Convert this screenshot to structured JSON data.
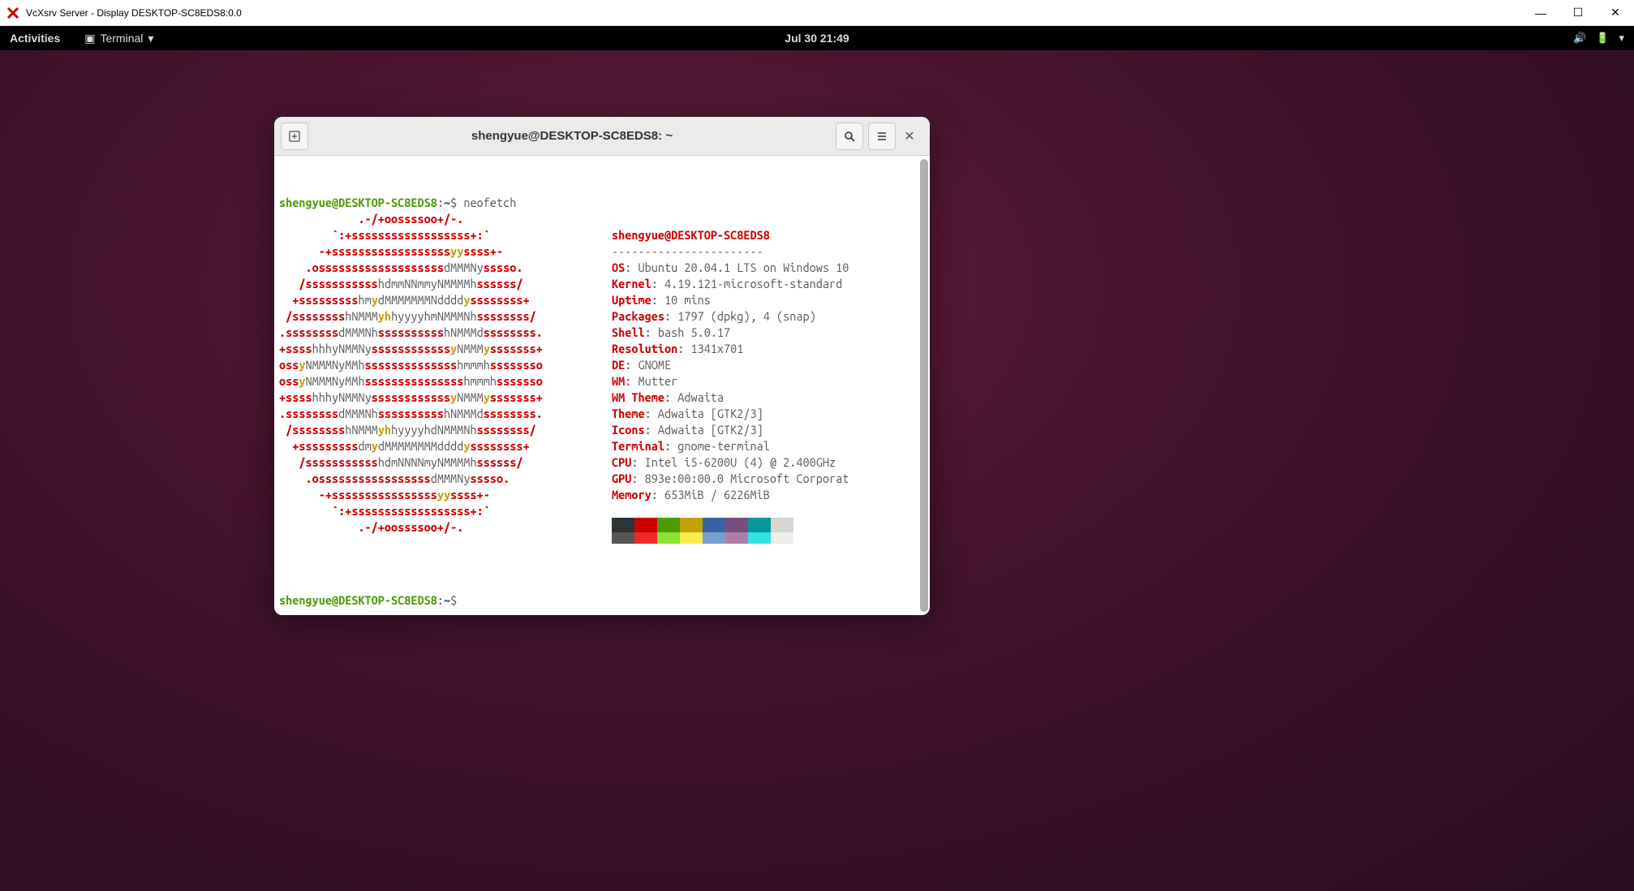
{
  "win": {
    "title": "VcXsrv Server - Display DESKTOP-SC8EDS8:0.0"
  },
  "gnome": {
    "activities": "Activities",
    "appmenu": "Terminal",
    "clock": "Jul 30  21:49"
  },
  "term": {
    "title": "shengyue@DESKTOP-SC8EDS8: ~",
    "prompt_user": "shengyue@DESKTOP-SC8EDS8",
    "prompt_sep": ":",
    "prompt_path": "~",
    "prompt_dollar": "$",
    "command": "neofetch",
    "header_user": "shengyue",
    "header_at": "@",
    "header_host": "DESKTOP-SC8EDS8",
    "dashes": "-----------------------",
    "info": {
      "os_k": "OS",
      "os_v": ": Ubuntu 20.04.1 LTS on Windows 10",
      "kernel_k": "Kernel",
      "kernel_v": ": 4.19.121-microsoft-standard",
      "uptime_k": "Uptime",
      "uptime_v": ": 10 mins",
      "packages_k": "Packages",
      "packages_v": ": 1797 (dpkg), 4 (snap)",
      "shell_k": "Shell",
      "shell_v": ": bash 5.0.17",
      "resolution_k": "Resolution",
      "resolution_v": ": 1341x701",
      "de_k": "DE",
      "de_v": ": GNOME",
      "wm_k": "WM",
      "wm_v": ": Mutter",
      "wmtheme_k": "WM Theme",
      "wmtheme_v": ": Adwaita",
      "theme_k": "Theme",
      "theme_v": ": Adwaita [GTK2/3]",
      "icons_k": "Icons",
      "icons_v": ": Adwaita [GTK2/3]",
      "terminal_k": "Terminal",
      "terminal_v": ": gnome-terminal",
      "cpu_k": "CPU",
      "cpu_v": ": Intel i5-6200U (4) @ 2.400GHz",
      "gpu_k": "GPU",
      "gpu_v": ": 893e:00:00.0 Microsoft Corporat",
      "memory_k": "Memory",
      "memory_v": ": 653MiB / 6226MiB"
    },
    "logo": [
      [
        [
          "r",
          "            .-/+oossssoo+/-."
        ]
      ],
      [
        [
          "r",
          "        `:+ssssssssssssssssss+:`"
        ]
      ],
      [
        [
          "r",
          "      -+ssssssssssssssssss"
        ],
        [
          "y",
          "yy"
        ],
        [
          "r",
          "ssss+-"
        ]
      ],
      [
        [
          "r",
          "    .osssssssssssssssssss"
        ],
        [
          "gr",
          "dMMMNy"
        ],
        [
          "r",
          "sssso."
        ]
      ],
      [
        [
          "r",
          "   /sssssssssss"
        ],
        [
          "gr",
          "hdmmNNmmyNMMMMh"
        ],
        [
          "r",
          "ssssss/"
        ]
      ],
      [
        [
          "r",
          "  +sssssssss"
        ],
        [
          "gr",
          "hm"
        ],
        [
          "y",
          "y"
        ],
        [
          "gr",
          "dMMMMMMMNdddd"
        ],
        [
          "y",
          "y"
        ],
        [
          "r",
          "ssssssss+"
        ]
      ],
      [
        [
          "r",
          " /ssssssss"
        ],
        [
          "gr",
          "hNMMM"
        ],
        [
          "y",
          "yh"
        ],
        [
          "gr",
          "hyyyyhmNMMMNh"
        ],
        [
          "r",
          "ssssssss/"
        ]
      ],
      [
        [
          "r",
          ".ssssssss"
        ],
        [
          "gr",
          "dMMMNh"
        ],
        [
          "r",
          "ssssssssss"
        ],
        [
          "gr",
          "hNMMMd"
        ],
        [
          "r",
          "ssssssss."
        ]
      ],
      [
        [
          "r",
          "+ssss"
        ],
        [
          "gr",
          "hhhyNMMNy"
        ],
        [
          "r",
          "ssssssssssss"
        ],
        [
          "y",
          "y"
        ],
        [
          "gr",
          "NMMM"
        ],
        [
          "y",
          "y"
        ],
        [
          "r",
          "sssssss+"
        ]
      ],
      [
        [
          "r",
          "oss"
        ],
        [
          "y",
          "y"
        ],
        [
          "gr",
          "NMMMNyMMh"
        ],
        [
          "r",
          "ssssssssssssss"
        ],
        [
          "gr",
          "hmmmh"
        ],
        [
          "r",
          "ssssssso"
        ]
      ],
      [
        [
          "r",
          "oss"
        ],
        [
          "y",
          "y"
        ],
        [
          "gr",
          "NMMMNyMMh"
        ],
        [
          "r",
          "sssssssssssssss"
        ],
        [
          "gr",
          "hmmmh"
        ],
        [
          "r",
          "sssssso"
        ]
      ],
      [
        [
          "r",
          "+ssss"
        ],
        [
          "gr",
          "hhhyNMMNy"
        ],
        [
          "r",
          "ssssssssssss"
        ],
        [
          "y",
          "y"
        ],
        [
          "gr",
          "NMMM"
        ],
        [
          "y",
          "y"
        ],
        [
          "r",
          "sssssss+"
        ]
      ],
      [
        [
          "r",
          ".ssssssss"
        ],
        [
          "gr",
          "dMMMNh"
        ],
        [
          "r",
          "ssssssssss"
        ],
        [
          "gr",
          "hNMMMd"
        ],
        [
          "r",
          "ssssssss."
        ]
      ],
      [
        [
          "r",
          " /ssssssss"
        ],
        [
          "gr",
          "hNMMM"
        ],
        [
          "y",
          "yh"
        ],
        [
          "gr",
          "hyyyyhdNMMMNh"
        ],
        [
          "r",
          "ssssssss/"
        ]
      ],
      [
        [
          "r",
          "  +sssssssss"
        ],
        [
          "gr",
          "dm"
        ],
        [
          "y",
          "y"
        ],
        [
          "gr",
          "dMMMMMMMMdddd"
        ],
        [
          "y",
          "y"
        ],
        [
          "r",
          "ssssssss+"
        ]
      ],
      [
        [
          "r",
          "   /sssssssssss"
        ],
        [
          "gr",
          "hdmNNNNmyNMMMMh"
        ],
        [
          "r",
          "ssssss/"
        ]
      ],
      [
        [
          "r",
          "    .osssssssssssssssss"
        ],
        [
          "gr",
          "dMMMNy"
        ],
        [
          "r",
          "sssso."
        ]
      ],
      [
        [
          "r",
          "      -+ssssssssssssssss"
        ],
        [
          "y",
          "yy"
        ],
        [
          "r",
          "ssss+-"
        ]
      ],
      [
        [
          "r",
          "        `:+ssssssssssssssssss+:`"
        ]
      ],
      [
        [
          "r",
          "            .-/+oossssoo+/-."
        ]
      ]
    ],
    "palette": {
      "row1": [
        "#2e3436",
        "#cc0000",
        "#4e9a06",
        "#c4a000",
        "#3465a4",
        "#75507b",
        "#06989a",
        "#d3d7cf"
      ],
      "row2": [
        "#555753",
        "#ef2929",
        "#8ae234",
        "#fce94f",
        "#729fcf",
        "#ad7fa8",
        "#34e2e2",
        "#eeeeec"
      ]
    }
  }
}
